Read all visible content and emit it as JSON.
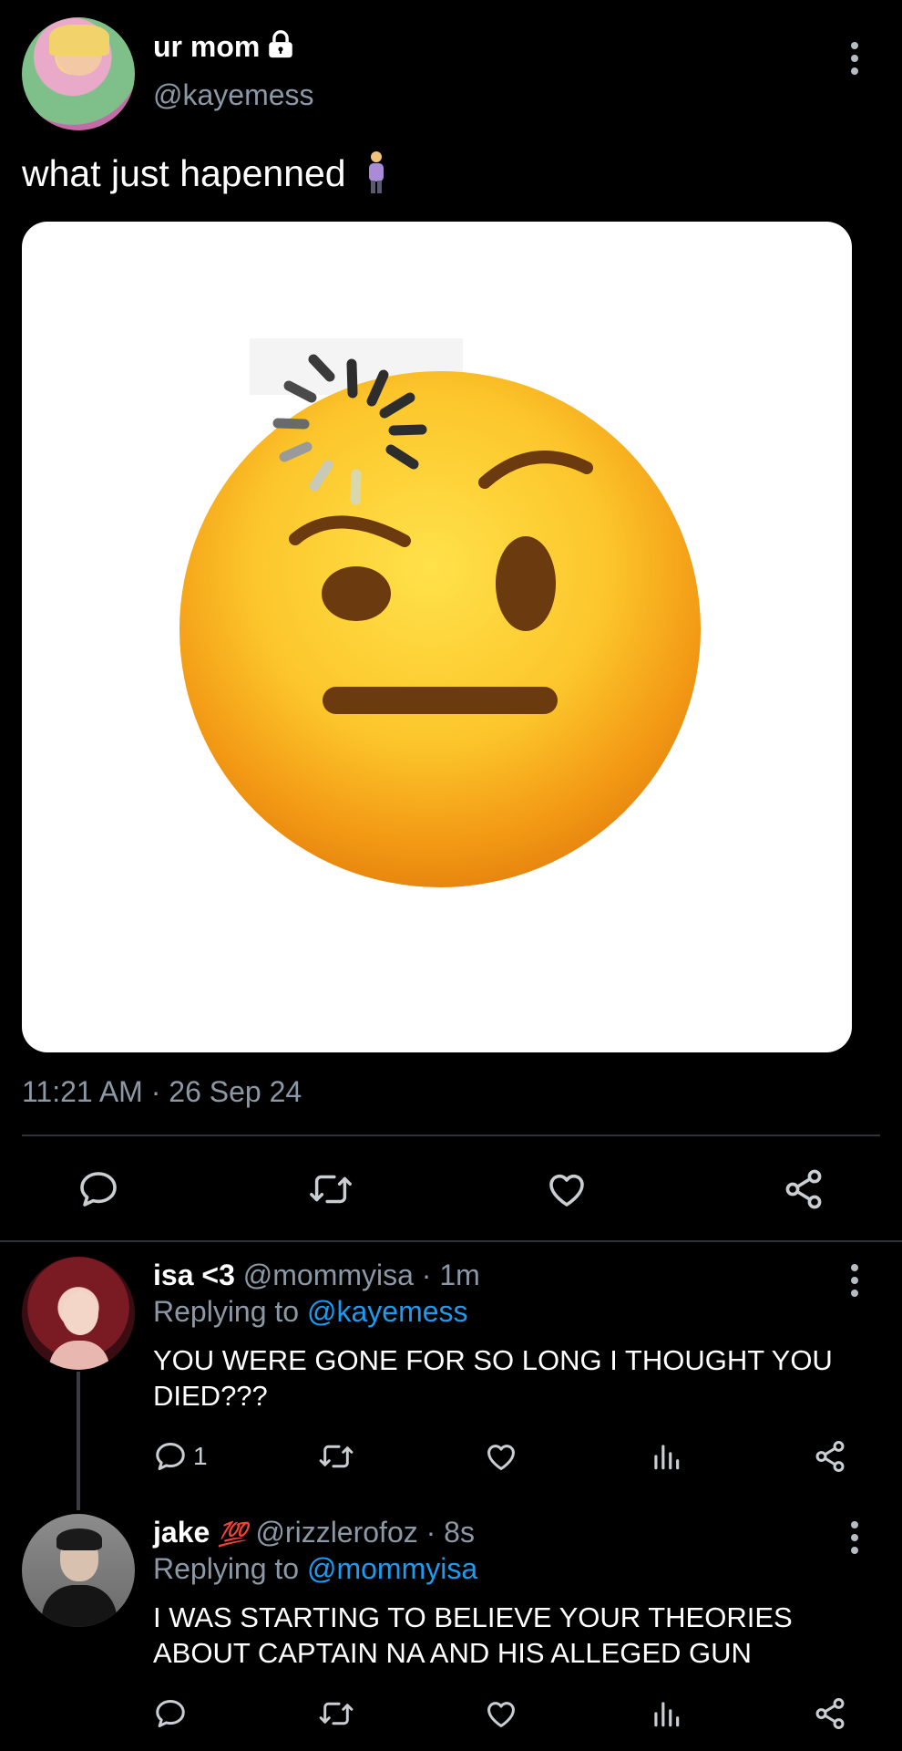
{
  "tweet": {
    "display_name": "ur mom",
    "handle": "@kayemess",
    "text": "what just hapenned",
    "timestamp": "11:21 AM · 26 Sep 24",
    "lock_icon": "lock-icon",
    "emoji": "person-standing-emoji",
    "media": "face-with-raised-eyebrow-loading-emoji"
  },
  "actions": [
    "reply-icon",
    "retweet-icon",
    "like-icon",
    "share-icon"
  ],
  "replies": [
    {
      "display_name": "isa <3",
      "handle": "@mommyisa",
      "time": "1m",
      "replying_prefix": "Replying to ",
      "replying_to": "@kayemess",
      "text": "YOU WERE GONE FOR SO LONG I THOUGHT YOU DIED???",
      "reply_count": "1"
    },
    {
      "display_name": "jake",
      "badge": "💯",
      "handle": "@rizzlerofoz",
      "time": "8s",
      "replying_prefix": "Replying to ",
      "replying_to": "@mommyisa",
      "text": "I WAS STARTING TO BELIEVE YOUR THEORIES ABOUT CAPTAIN NA AND HIS ALLEGED GUN",
      "reply_count": ""
    }
  ],
  "colors": {
    "background": "#000000",
    "accent": "#1d9bf0",
    "muted": "#8b98a5"
  }
}
